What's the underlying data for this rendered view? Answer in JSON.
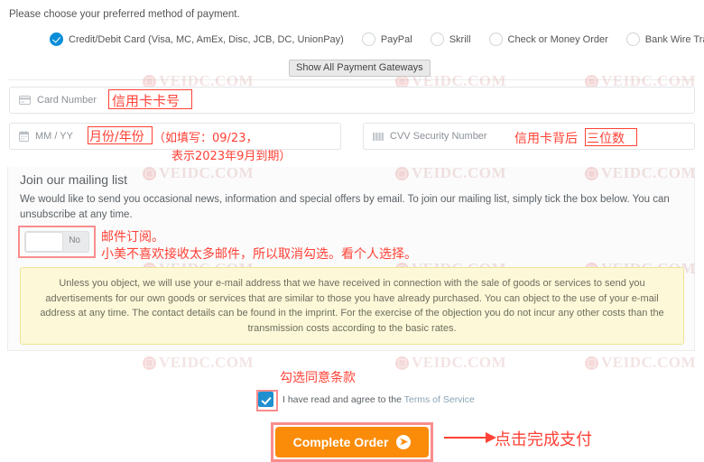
{
  "intro": {
    "text": "Please choose your preferred method of payment."
  },
  "payment_methods": [
    {
      "label": "Credit/Debit Card (Visa, MC, AmEx, Disc, JCB, DC, UnionPay)",
      "selected": true
    },
    {
      "label": "PayPal",
      "selected": false
    },
    {
      "label": "Skrill",
      "selected": false
    },
    {
      "label": "Check or Money Order",
      "selected": false
    },
    {
      "label": "Bank Wire Transfer",
      "selected": false
    }
  ],
  "gateways_button": {
    "label": "Show All Payment Gateways"
  },
  "fields": {
    "card_number": {
      "placeholder": "Card Number",
      "value": "",
      "icon": "credit-card-icon"
    },
    "expiry": {
      "placeholder": "MM / YY",
      "value": "",
      "icon": "calendar-icon"
    },
    "cvv": {
      "placeholder": "CVV Security Number",
      "value": "",
      "icon": "cvv-stripe-icon"
    }
  },
  "mailing": {
    "title": "Join our mailing list",
    "body": "We would like to send you occasional news, information and special offers by email. To join our mailing list, simply tick the box below. You can unsubscribe at any time.",
    "toggle_label": "No",
    "toggle_state": "off",
    "notice": "Unless you object, we will use your e-mail address that we have received in connection with the sale of goods or services to send you advertisements for our own goods or services that are similar to those you have already purchased. You can object to the use of your e-mail address at any time. The contact details can be found in the imprint. For the exercise of the objection you do not incur any other costs than the transmission costs according to the basic rates."
  },
  "agree": {
    "checked": true,
    "text_before": "I have read and agree to the ",
    "link_text": "Terms of Service"
  },
  "order_button": {
    "label": "Complete Order",
    "arrow": "arrow-right-circle-icon"
  },
  "annotations": {
    "card_number": "信用卡卡号",
    "expiry": "月份/年份",
    "expiry_note_line1": "（如填写：09/23，",
    "expiry_note_line2": "表示2023年9月到期）",
    "cvv_prefix": "信用卡背后",
    "cvv_boxed": "三位数",
    "mailing_line1": "邮件订阅。",
    "mailing_line2": "小美不喜欢接收太多邮件，所以取消勾选。看个人选择。",
    "agree": "勾选同意条款",
    "order": "点击完成支付"
  },
  "watermark": {
    "text": "VEIDC.COM"
  },
  "colors": {
    "accent_blue": "#0a8ed9",
    "order_orange": "#fb8c09",
    "annotation_red": "#ff4136",
    "notice_bg": "#fdf8d8",
    "notice_border": "#efe49a"
  }
}
